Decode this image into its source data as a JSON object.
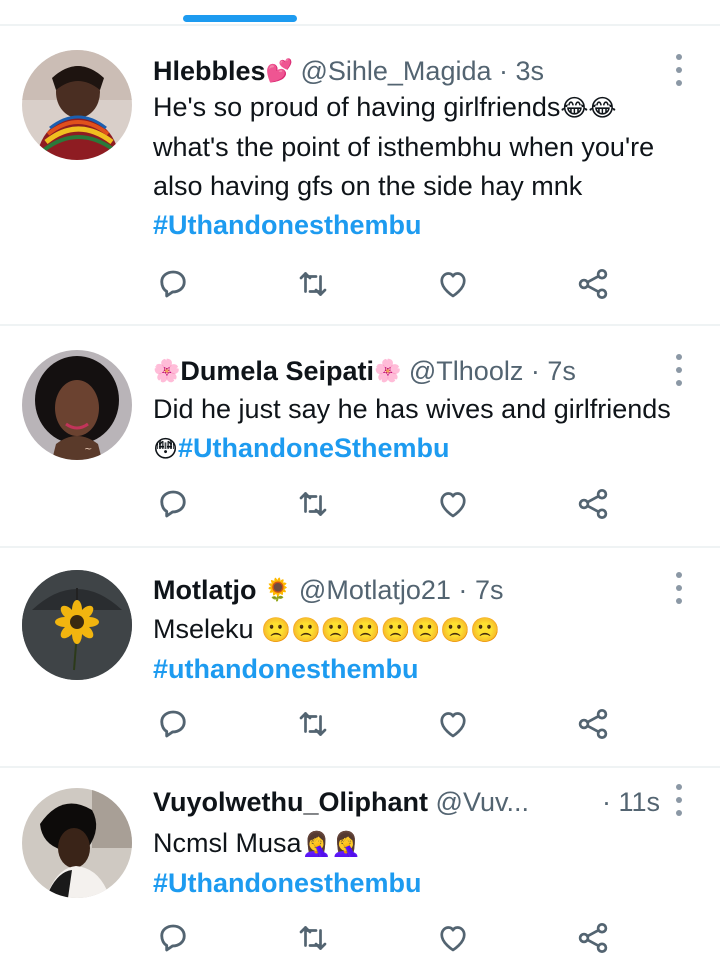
{
  "tweets": [
    {
      "name": "Hlebbles",
      "name_suffix": "💕",
      "handle": "@Sihle_Magida",
      "dot": "·",
      "time": "3s",
      "text": "He's so proud of having girlfriends",
      "text_emojis": "😂😂",
      "text_more": "what's the point of isthembhu when you're also having gfs on the side hay mnk",
      "hashtag": "#Uthandonesthembu"
    },
    {
      "name_prefix": "🌸",
      "name": "Dumela Seipati",
      "name_suffix": "🌸",
      "handle": "@Tlhoolz",
      "dot": "·",
      "time": "7s",
      "text": "Did he just say he has wives and girlfriends",
      "text_emojis": "😳",
      "hashtag": "#UthandoneSthembu"
    },
    {
      "name": "Motlatjo",
      "name_suffix": "🌻",
      "handle": "@Motlatjo21",
      "dot": "·",
      "time": "7s",
      "text": "Mseleku",
      "text_emojis": "🙁🙁🙁🙁🙁🙁🙁🙁",
      "hashtag": "#uthandonesthembu"
    },
    {
      "name": "Vuyolwethu_Oliphant",
      "handle": "@Vuv...",
      "dot": "·",
      "time": "11s",
      "text": "Ncmsl Musa",
      "text_emojis": "🤦‍♀️🤦‍♀️",
      "hashtag": "#Uthandonesthembu"
    }
  ],
  "icons": {
    "reply": "reply-icon",
    "retweet": "retweet-icon",
    "like": "like-icon",
    "share": "share-icon",
    "more": "more-vertical-icon"
  },
  "colors": {
    "accent": "#1d9bf0",
    "secondary_text": "#536471",
    "icon": "#536471",
    "divider": "#eff3f4"
  }
}
